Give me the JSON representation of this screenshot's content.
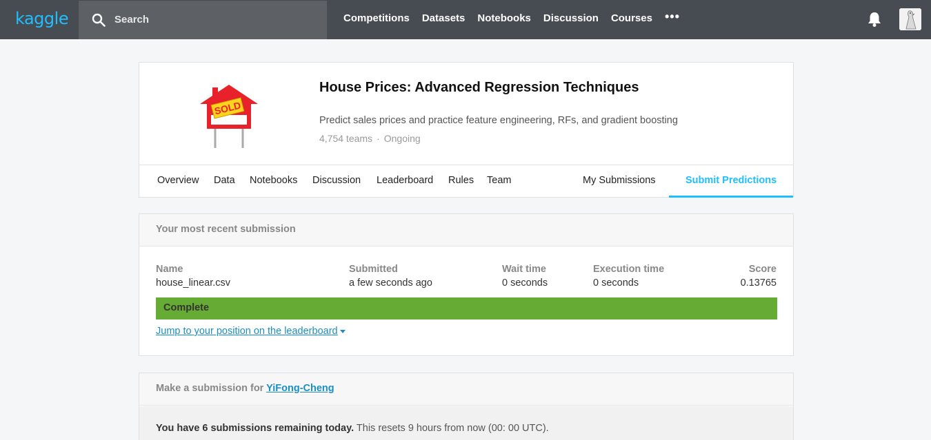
{
  "topbar": {
    "logo": "kaggle",
    "search_placeholder": "Search",
    "nav": [
      "Competitions",
      "Datasets",
      "Notebooks",
      "Discussion",
      "Courses"
    ],
    "more_label": "•••"
  },
  "competition": {
    "title": "House Prices: Advanced Regression Techniques",
    "description": "Predict sales prices and practice feature engineering, RFs, and gradient boosting",
    "teams": "4,754 teams",
    "separator": "·",
    "status": "Ongoing",
    "logo_sign_text": "SOLD",
    "tabs": [
      "Overview",
      "Data",
      "Notebooks",
      "Discussion",
      "Leaderboard",
      "Rules",
      "Team"
    ],
    "my_submissions": "My Submissions",
    "submit_predictions": "Submit Predictions"
  },
  "recent": {
    "heading": "Your most recent submission",
    "columns": {
      "name": "Name",
      "submitted": "Submitted",
      "wait": "Wait time",
      "execution": "Execution time",
      "score": "Score"
    },
    "values": {
      "name": "house_linear.csv",
      "submitted": "a few seconds ago",
      "wait": "0 seconds",
      "execution": "0 seconds",
      "score": "0.13765"
    },
    "status": "Complete",
    "jump_link": "Jump to your position on the leaderboard"
  },
  "make_submission": {
    "label": "Make a submission for",
    "user": "YiFong-Cheng",
    "remaining_bold": "You have 6 submissions remaining today.",
    "remaining_rest": " This resets 9 hours from now (00: 00 UTC)."
  },
  "colors": {
    "accent": "#20beff",
    "topbar": "#474c52",
    "complete": "#66ab33",
    "link": "#1b8ec2"
  }
}
